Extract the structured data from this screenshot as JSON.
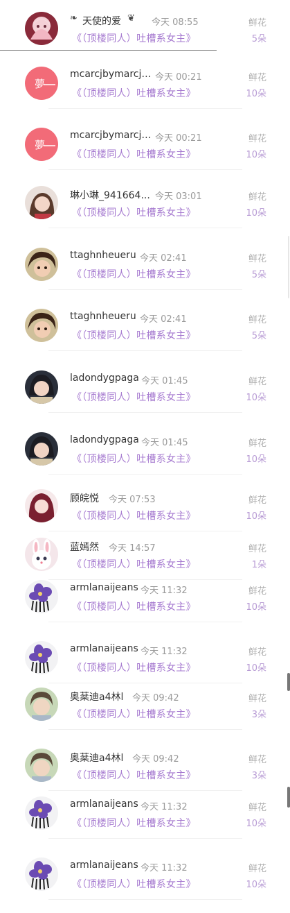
{
  "gift_label": "鲜花",
  "book_title": "《（顶楼同人）吐槽系女主》",
  "rows": [
    {
      "name": "天使的爱",
      "time": "今天 08:55",
      "count": "5朵",
      "avatar": "pink-anime-girl"
    },
    {
      "name": "mcarcjbymarcjt...",
      "time": "今天 00:21",
      "count": "10朵",
      "avatar": "pink-dream-badge"
    },
    {
      "name": "mcarcjbymarcjt...",
      "time": "今天 00:21",
      "count": "10朵",
      "avatar": "pink-dream-badge"
    },
    {
      "name": "琳小琳_941664...",
      "time": "今天 03:01",
      "count": "10朵",
      "avatar": "girl-photo"
    },
    {
      "name": "ttaghnheueru",
      "time": "今天 02:41",
      "count": "5朵",
      "avatar": "child-photo"
    },
    {
      "name": "ttaghnheueru",
      "time": "今天 02:41",
      "count": "5朵",
      "avatar": "child-photo"
    },
    {
      "name": "ladondygpaga",
      "time": "今天 01:45",
      "count": "10朵",
      "avatar": "girl-photo-2"
    },
    {
      "name": "ladondygpaga",
      "time": "今天 01:45",
      "count": "10朵",
      "avatar": "girl-photo-2"
    },
    {
      "name": "顾皖悦",
      "time": "今天 07:53",
      "count": "10朵",
      "avatar": "red-hair-girl"
    },
    {
      "name": "蓝嫣然",
      "time": "今天 14:57",
      "count": "1朵",
      "avatar": "white-rabbit"
    },
    {
      "name": "armlanaijeans",
      "time": "今天 11:32",
      "count": "10朵",
      "avatar": "purple-flower"
    },
    {
      "name": "armlanaijeans",
      "time": "今天 11:32",
      "count": "10朵",
      "avatar": "purple-flower"
    },
    {
      "name": "奥棻迪a4林l",
      "time": "今天 09:42",
      "count": "3朵",
      "avatar": "boy-photo"
    },
    {
      "name": "奥棻迪a4林l",
      "time": "今天 09:42",
      "count": "3朵",
      "avatar": "boy-photo"
    },
    {
      "name": "armlanaijeans",
      "time": "今天 11:32",
      "count": "10朵",
      "avatar": "purple-flower"
    },
    {
      "name": "armlanaijeans",
      "time": "今天 11:32",
      "count": "10朵",
      "avatar": "purple-flower"
    }
  ]
}
